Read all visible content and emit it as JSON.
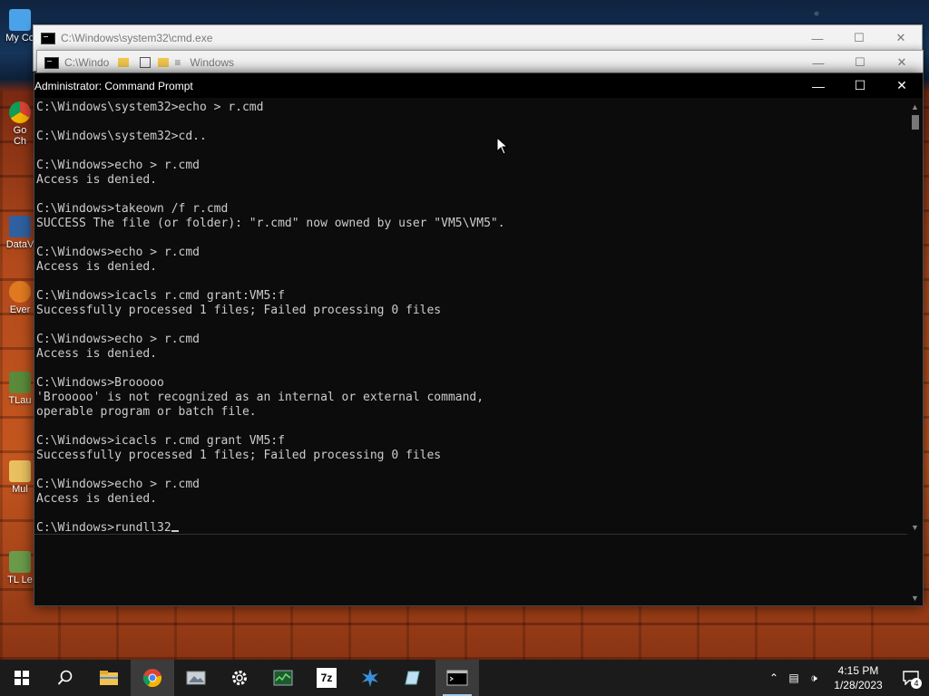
{
  "desktop": {
    "icons": [
      {
        "label": "My Co"
      },
      {
        "label": "Go\nCh"
      },
      {
        "label": "DataV"
      },
      {
        "label": "Ever"
      },
      {
        "label": "TLau"
      },
      {
        "label": "Mul"
      },
      {
        "label": "TL Le"
      }
    ]
  },
  "windows": {
    "back1": {
      "title": "C:\\Windows\\system32\\cmd.exe"
    },
    "back2": {
      "title": "C:\\Windo",
      "explorer_title": "Windows"
    },
    "main": {
      "title": "Administrator: Command Prompt"
    }
  },
  "console": {
    "lines": [
      "C:\\Windows\\system32>echo > r.cmd",
      "",
      "C:\\Windows\\system32>cd..",
      "",
      "C:\\Windows>echo > r.cmd",
      "Access is denied.",
      "",
      "C:\\Windows>takeown /f r.cmd",
      "SUCCESS The file (or folder): \"r.cmd\" now owned by user \"VM5\\VM5\".",
      "",
      "C:\\Windows>echo > r.cmd",
      "Access is denied.",
      "",
      "C:\\Windows>icacls r.cmd grant:VM5:f",
      "Successfully processed 1 files; Failed processing 0 files",
      "",
      "C:\\Windows>echo > r.cmd",
      "Access is denied.",
      "",
      "C:\\Windows>Brooooo",
      "'Brooooo' is not recognized as an internal or external command,",
      "operable program or batch file.",
      "",
      "C:\\Windows>icacls r.cmd grant VM5:f",
      "Successfully processed 1 files; Failed processing 0 files",
      "",
      "C:\\Windows>echo > r.cmd",
      "Access is denied.",
      "",
      "C:\\Windows>rundll32"
    ]
  },
  "taskbar": {
    "apps": [
      {
        "name": "start-icon"
      },
      {
        "name": "search-icon"
      },
      {
        "name": "file-explorer-icon"
      },
      {
        "name": "chrome-icon"
      },
      {
        "name": "image-viewer-icon"
      },
      {
        "name": "settings-icon"
      },
      {
        "name": "task-manager-icon"
      },
      {
        "name": "7zip-icon"
      },
      {
        "name": "app-icon"
      },
      {
        "name": "notepad-icon"
      },
      {
        "name": "command-prompt-icon"
      }
    ],
    "sevenzip_label": "7z",
    "time": "4:15 PM",
    "date": "1/28/2023",
    "notification_count": "4"
  }
}
